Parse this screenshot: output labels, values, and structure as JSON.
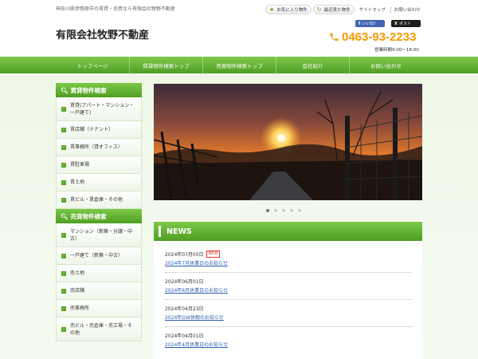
{
  "header": {
    "tagline": "神奈川県伊勢原市の賃貸・売買なら有限会社牧野不動産",
    "favorites_label": "お気に入り物件",
    "recent_label": "最近見た物件",
    "sitemap_label": "サイトマップ",
    "contact_label": "お問い合わせ",
    "site_title": "有限会社牧野不動産",
    "fb_label": "いいね！",
    "tw_label": "ポスト",
    "phone": "0463-93-2233",
    "hours": "営業時間9:00～18:00"
  },
  "nav": {
    "items": [
      {
        "label": "トップページ"
      },
      {
        "label": "賃貸物件検索トップ"
      },
      {
        "label": "売買物件検索トップ"
      },
      {
        "label": "会社紹介"
      },
      {
        "label": "お問い合わせ"
      }
    ]
  },
  "sidebar": {
    "rent_heading": "賃貸物件検索",
    "rent_items": [
      {
        "label": "賃貸(アパート・マンション・一戸建て)"
      },
      {
        "label": "賃店舗（テナント）"
      },
      {
        "label": "賃事務所（貸オフィス）"
      },
      {
        "label": "賃駐車場"
      },
      {
        "label": "賃土地"
      },
      {
        "label": "賃ビル・賃倉庫・その他"
      }
    ],
    "sale_heading": "売買物件検索",
    "sale_items": [
      {
        "label": "マンション（新築・分譲・中古）"
      },
      {
        "label": "一戸建て（新築・中古）"
      },
      {
        "label": "売土地"
      },
      {
        "label": "売店舗"
      },
      {
        "label": "売事務所"
      },
      {
        "label": "売ビル・売倉庫・売工場・その他"
      }
    ]
  },
  "slider": {
    "active_index": 0,
    "count": 5
  },
  "news": {
    "heading": "NEWS",
    "new_badge": "NEW",
    "items": [
      {
        "date": "2024年07月05日",
        "title": "2024年7月休業日のお知らせ"
      },
      {
        "date": "2024年06月01日",
        "title": "2024年6月休業日のお知らせ"
      },
      {
        "date": "2024年04月23日",
        "title": "2024年GW休暇のお知らせ"
      },
      {
        "date": "2024年04月01日",
        "title": "2024年4月休業日のお知らせ"
      }
    ]
  },
  "colors": {
    "brand_green": "#5aa626",
    "phone_orange": "#f39800",
    "link_blue": "#2a5db0"
  }
}
